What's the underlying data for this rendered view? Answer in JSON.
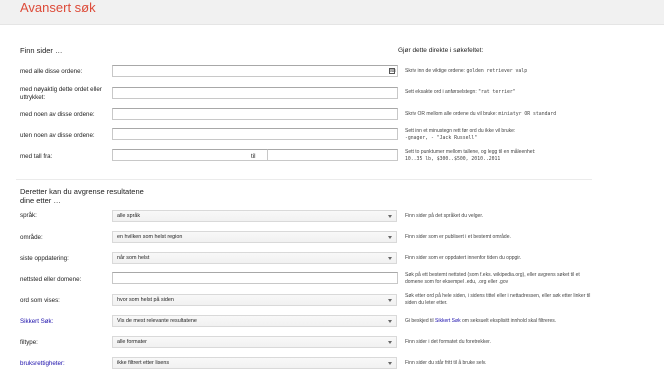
{
  "header": {
    "title": "Avansert søk"
  },
  "find_pages": {
    "section_title": "Finn sider …",
    "hint_title": "Gjør dette direkte i søkefeltet:",
    "rows": [
      {
        "label": "med alle disse ordene:",
        "hint_prefix": "Skriv inn de viktige ordene:",
        "hint_example": "golden retriever valp"
      },
      {
        "label": "med nøyaktig dette ordet eller uttrykket:",
        "hint_prefix": "Sett eksakte ord i anførselstegn:",
        "hint_example": "\"rat terrier\""
      },
      {
        "label": "med noen av disse ordene:",
        "hint_prefix": "Skriv OR mellom alle ordene du vil bruke:",
        "hint_example": "miniatyr OR standard"
      },
      {
        "label": "uten noen av disse ordene:",
        "hint_prefix": "Sett inn et minustegn rett før ord du ikke vil bruke:",
        "hint_example": "-gnager, - \"Jack Russell\""
      },
      {
        "label": "med tall fra:",
        "to_label": "til",
        "hint_prefix": "Sett to punktumer mellom tallene, og legg til en måleenhet:",
        "hint_example": "10..35 lb, $300..$500, 2010..2011"
      }
    ]
  },
  "narrow": {
    "section_title": "Deretter kan du avgrense resultatene dine etter …",
    "rows": [
      {
        "label": "språk:",
        "value": "alle språk",
        "hint": "Finn sider på det språket du velger."
      },
      {
        "label": "område:",
        "value": "en hvilken som helst region",
        "hint": "Finn sider som er publisert i et bestemt område."
      },
      {
        "label": "siste oppdatering:",
        "value": "når som helst",
        "hint": "Finn sider som er oppdatert innenfor tiden du oppgir."
      },
      {
        "label": "nettsted eller domene:",
        "hint": "Søk på ett bestemt nettsted (som f.eks. wikipedia.org), eller avgrens søket til et domene som for eksempel .edu, .org eller .gov"
      },
      {
        "label": "ord som vises:",
        "value": "hvor som helst på siden",
        "hint": "Søk etter ord på hele siden, i sidens tittel eller i nettadressen, eller søk etter linker til siden du leter etter."
      },
      {
        "label": "Sikkert Søk:",
        "value": "Vis de mest relevante resultatene",
        "hint_prefix": "Gi beskjed til ",
        "hint_link": "Sikkert Søk",
        "hint_suffix": " om seksuelt eksplisitt innhold skal filtreres."
      },
      {
        "label": "filtype:",
        "value": "alle formater",
        "hint": "Finn sider i det formatet du foretrekker."
      },
      {
        "label": "bruksrettigheter:",
        "value": "ikke filtrert etter lisens",
        "hint": "Finn sider du står fritt til å bruke selv."
      }
    ]
  },
  "colors": {
    "title": "#dd4b39",
    "link": "#1a0dab"
  },
  "icons": {
    "keyboard": "keyboard-icon",
    "dropdown": "chevron-down-icon"
  }
}
